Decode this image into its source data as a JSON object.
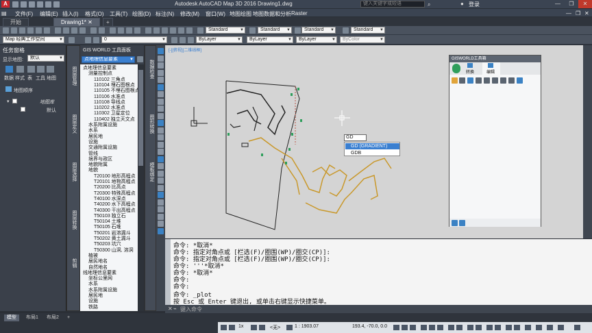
{
  "titlebar": {
    "logo": "A",
    "title": "Autodesk AutoCAD Map 3D 2016    Drawing1.dwg",
    "search_placeholder": "键入关键字或短语",
    "login": "登录"
  },
  "menu": [
    "文件(F)",
    "编辑(E)",
    "插入(I)",
    "格式(O)",
    "工具(T)",
    "绘图(D)",
    "标注(N)",
    "修改(M)",
    "窗口(W)",
    "地图绘图",
    "地图数据和分析",
    "Raster"
  ],
  "tabs": [
    {
      "label": "开始"
    },
    {
      "label": "Drawing1*"
    },
    {
      "label": "+"
    }
  ],
  "toolbar": {
    "workspace": "Map 经典工作空间",
    "layer_name": "0",
    "styles": [
      "Standard",
      "Standard",
      "Standard",
      "Standard"
    ],
    "bylayer": [
      "ByLayer",
      "ByLayer",
      "ByLayer"
    ],
    "bycolor": "ByColor"
  },
  "left_panel": {
    "title": "任务窗格",
    "display_label": "显示地图:",
    "display_value": "默认",
    "tools": [
      "数据",
      "样式",
      "表",
      "工具",
      "地图"
    ],
    "map_order": "地图顺序",
    "tree": [
      "地图库",
      "默认"
    ]
  },
  "gis_panel": {
    "title": "GIS WORLD 工具面板",
    "selected": "点地理信息要素",
    "items": [
      "点地理信息要素",
      "测量控制点",
      "110102 三角点",
      "110104 埋石图根点",
      "110105 不埋石图根点",
      "110106 水准点",
      "110108 导线点",
      "110202 水准点",
      "110302 卫星定位",
      "110402 独立天文点",
      "水系附属设施",
      "水系",
      "居民地",
      "设施",
      "交通附属设施",
      "管线",
      "境界与政区",
      "地貌附属",
      "地貌",
      "T20100 地形高程点",
      "T20101 地物高程点",
      "T20200 比高点",
      "T20300 特殊高程点",
      "T40100 水深点",
      "T40200 水下高程点",
      "T40300 干出高程点",
      "T50103 独立石",
      "T50104 土堆",
      "T50105 石堆",
      "T50201 岩溶漏斗",
      "T50202 黄土漏斗",
      "T50203 坑穴",
      "T50300 山洞, 溶洞",
      "植被",
      "居民地名",
      "自然地名",
      "线地理信息要素",
      "坐标公里网",
      "水系",
      "水系附属设施",
      "居民地",
      "设施",
      "铁路"
    ]
  },
  "side_strips": {
    "a": [
      "图层管理",
      "图层定义",
      "图层选择",
      "图层转换",
      "剪辑"
    ],
    "b": [
      "数据检查",
      "图形转换"
    ],
    "c": [
      "模板绑定"
    ]
  },
  "drawing": {
    "viewport_label": "[-][俯视][二维线框]",
    "axis_y": "Y",
    "axis_x": "X"
  },
  "gisworld_window": {
    "title": "GISWORLD工具箱",
    "tabs": [
      "转换",
      "编辑"
    ]
  },
  "autocomplete": {
    "input": "GD",
    "options": [
      "GD (GRADIENT)",
      "GDB"
    ]
  },
  "command_history": [
    "命令: *取消*",
    "命令: 指定对角点或 [栏选(F)/圈围(WP)/圈交(CP)]:",
    "命令: 指定对角点或 [栏选(F)/圈围(WP)/圈交(CP)]:",
    "命令: '''*取消*",
    "命令: *取消*",
    "命令:",
    "命令:",
    "命令: _plot",
    "按 Esc 或 Enter 键退出, 或单击右键显示快捷菜单。"
  ],
  "command_prompt": "键入命令",
  "status": {
    "layouts": [
      "模型",
      "布局1",
      "布局2",
      "+"
    ],
    "scale_lbl": "1x",
    "none_lbl": "<无>",
    "ratio": "1 : 1903.07",
    "coords": "193.4, -70.0, 0.0"
  },
  "colors": {
    "accent_selection": "#3a7fd0",
    "road_color": "#c9982a",
    "green_marker": "#2e9e5b"
  }
}
